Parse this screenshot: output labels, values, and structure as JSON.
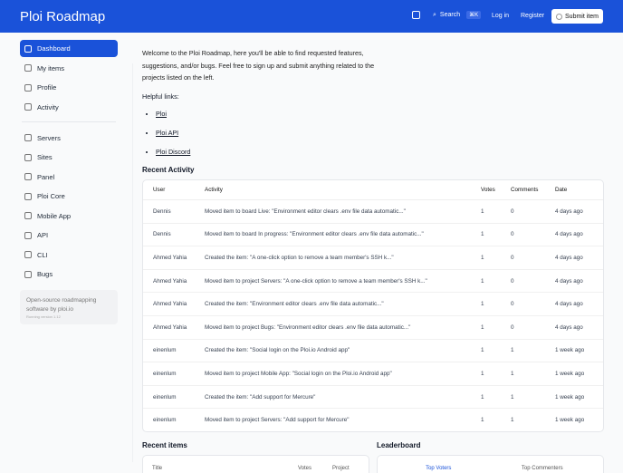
{
  "header": {
    "title": "Ploi Roadmap",
    "search_label": "Search",
    "search_shortcut": "⌘K",
    "login": "Log in",
    "register": "Register",
    "submit": "Submit item"
  },
  "sidebar": {
    "items": [
      {
        "label": "Dashboard",
        "icon": "home-icon"
      },
      {
        "label": "My items",
        "icon": "list-icon"
      },
      {
        "label": "Profile",
        "icon": "user-icon"
      },
      {
        "label": "Activity",
        "icon": "clock-icon"
      }
    ],
    "projects": [
      {
        "label": "Servers",
        "icon": "server-icon"
      },
      {
        "label": "Sites",
        "icon": "globe-icon"
      },
      {
        "label": "Panel",
        "icon": "monitor-icon"
      },
      {
        "label": "Ploi Core",
        "icon": "globe-icon"
      },
      {
        "label": "Mobile App",
        "icon": "phone-icon"
      },
      {
        "label": "API",
        "icon": "code-icon"
      },
      {
        "label": "CLI",
        "icon": "terminal-icon"
      },
      {
        "label": "Bugs",
        "icon": "bug-icon"
      }
    ],
    "about": "Open-source roadmapping software by ploi.io",
    "version": "Running version 1.12"
  },
  "main": {
    "intro": "Welcome to the Ploi Roadmap, here you'll be able to find requested features, suggestions, and/or bugs. Feel free to sign up and submit anything related to the projects listed on the left.",
    "helpful": "Helpful links:",
    "links": [
      "Ploi",
      "Ploi API",
      "Ploi Discord"
    ],
    "recent_activity": {
      "title": "Recent Activity",
      "columns": [
        "User",
        "Activity",
        "Votes",
        "Comments",
        "Date"
      ],
      "rows": [
        [
          "Dennis",
          "Moved item to board Live: \"Environment editor clears .env file data automatic...\"",
          "1",
          "0",
          "4 days ago"
        ],
        [
          "Dennis",
          "Moved item to board In progress: \"Environment editor clears .env file data automatic...\"",
          "1",
          "0",
          "4 days ago"
        ],
        [
          "Ahmed Yahia",
          "Created the item: \"A one-click option to remove a team member's SSH k...\"",
          "1",
          "0",
          "4 days ago"
        ],
        [
          "Ahmed Yahia",
          "Moved item to project Servers: \"A one-click option to remove a team member's SSH k...\"",
          "1",
          "0",
          "4 days ago"
        ],
        [
          "Ahmed Yahia",
          "Created the item: \"Environment editor clears .env file data automatic...\"",
          "1",
          "0",
          "4 days ago"
        ],
        [
          "Ahmed Yahia",
          "Moved item to project Bugs: \"Environment editor clears .env file data automatic...\"",
          "1",
          "0",
          "4 days ago"
        ],
        [
          "einenlum",
          "Created the item: \"Social login on the Ploi.io Android app\"",
          "1",
          "1",
          "1 week ago"
        ],
        [
          "einenlum",
          "Moved item to project Mobile App: \"Social login on the Ploi.io Android app\"",
          "1",
          "1",
          "1 week ago"
        ],
        [
          "einenlum",
          "Created the item: \"Add support for Mercure\"",
          "1",
          "1",
          "1 week ago"
        ],
        [
          "einenlum",
          "Moved item to project Servers: \"Add support for Mercure\"",
          "1",
          "1",
          "1 week ago"
        ]
      ]
    },
    "recent_items": {
      "title": "Recent items",
      "columns": [
        "Title",
        "Votes",
        "Project"
      ]
    },
    "leaderboard": {
      "title": "Leaderboard",
      "tabs": [
        "Top Voters",
        "Top Commenters"
      ]
    }
  }
}
